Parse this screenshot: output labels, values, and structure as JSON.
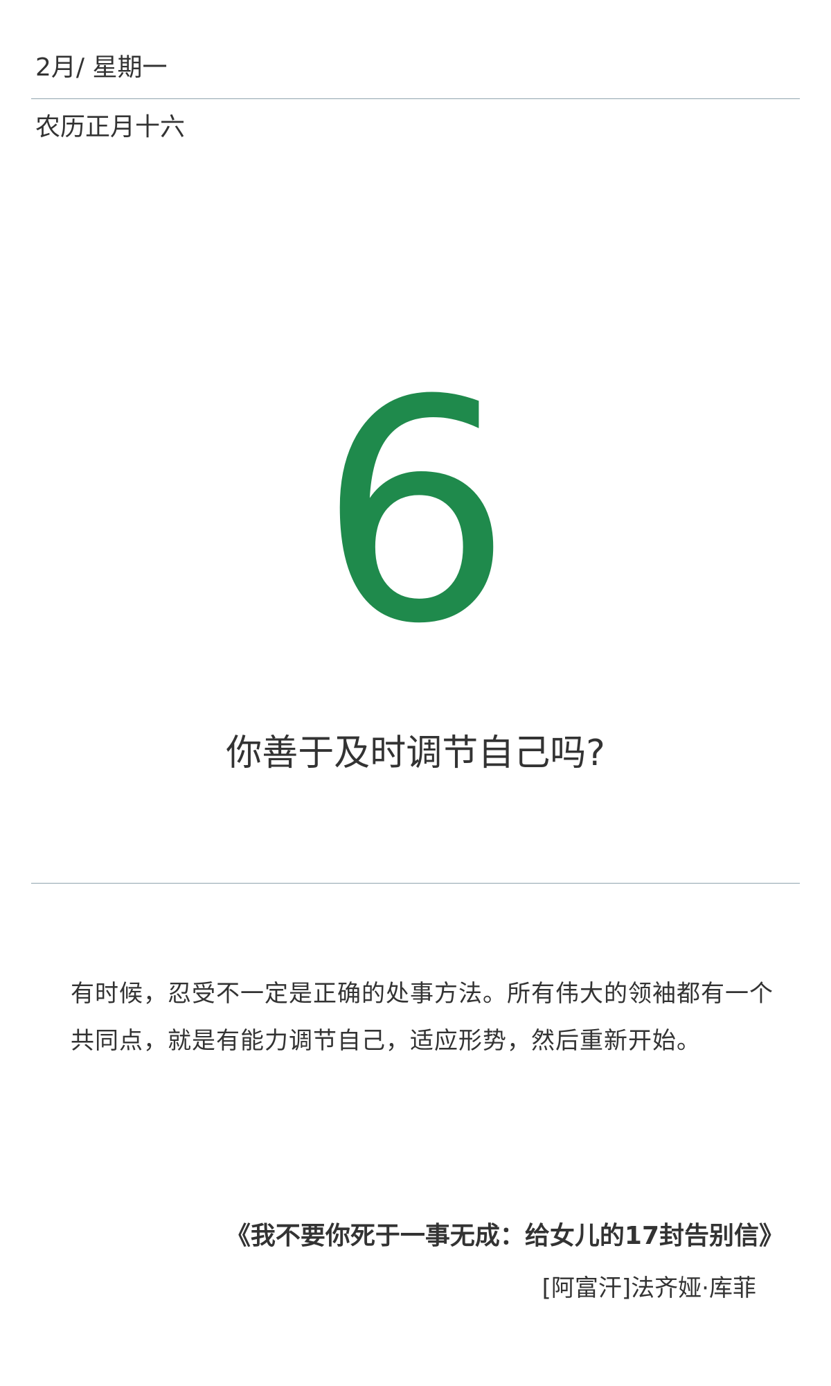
{
  "header": {
    "month_weekday": "2月/ 星期一",
    "lunar_date": "农历正月十六"
  },
  "day": {
    "number": "6",
    "color": "#1f8a4c"
  },
  "question": "你善于及时调节自己吗?",
  "passage": "有时候，忍受不一定是正确的处事方法。所有伟大的领袖都有一个共同点，就是有能力调节自己，适应形势，然后重新开始。",
  "source": {
    "book_title": "《我不要你死于一事无成：给女儿的17封告别信》",
    "author": "[阿富汗]法齐娅·库菲"
  }
}
